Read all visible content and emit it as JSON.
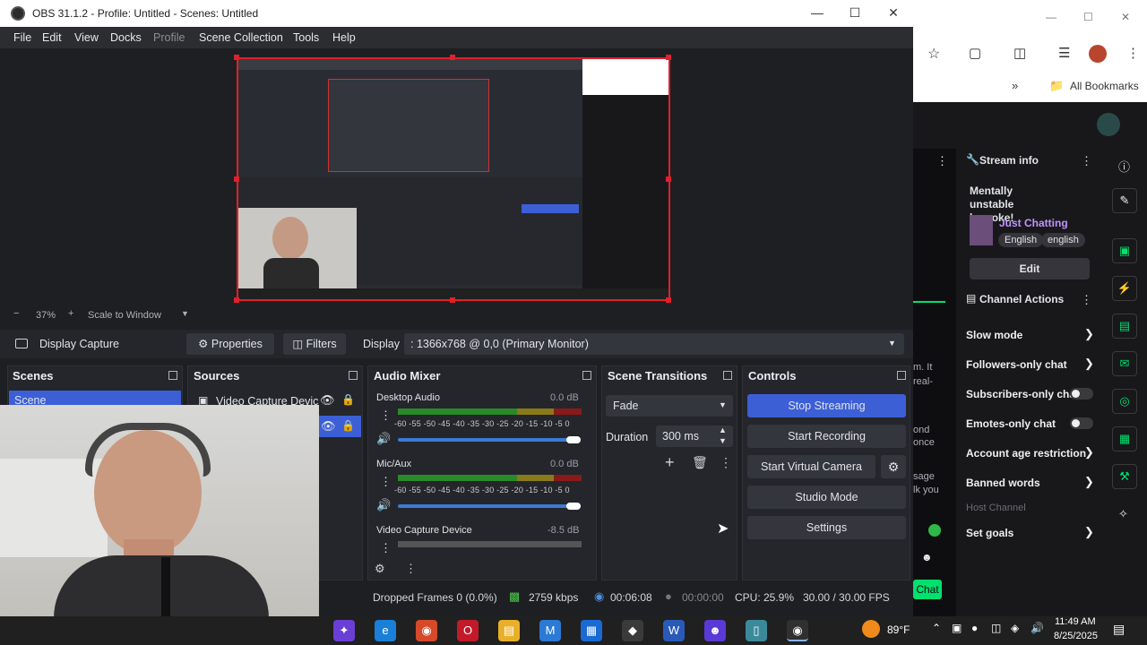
{
  "window": {
    "title": "OBS 31.1.2 - Profile: Untitled - Scenes: Untitled"
  },
  "menu": [
    "File",
    "Edit",
    "View",
    "Docks",
    "Profile",
    "Scene Collection",
    "Tools",
    "Help"
  ],
  "zoom": {
    "percent": "37%",
    "mode": "Scale to Window"
  },
  "source_toolbar": {
    "source_name": "Display Capture",
    "properties": "Properties",
    "filters": "Filters",
    "display_label": "Display",
    "display_value": ": 1366x768 @ 0,0 (Primary Monitor)"
  },
  "docks": {
    "scenes": {
      "title": "Scenes",
      "items": [
        "Scene"
      ]
    },
    "sources": {
      "title": "Sources",
      "items": [
        "Video Capture Devic"
      ]
    },
    "mixer": {
      "title": "Audio Mixer",
      "scale": "-60 -55 -50 -45 -40 -35 -30 -25 -20 -15 -10 -5 0",
      "channels": [
        {
          "name": "Desktop Audio",
          "db": "0.0 dB",
          "volume": 1.0
        },
        {
          "name": "Mic/Aux",
          "db": "0.0 dB",
          "volume": 1.0
        },
        {
          "name": "Video Capture Device",
          "db": "-8.5 dB",
          "volume": 0.85
        }
      ]
    },
    "transitions": {
      "title": "Scene Transitions",
      "type": "Fade",
      "duration_label": "Duration",
      "duration": "300 ms"
    },
    "controls": {
      "title": "Controls",
      "stop_streaming": "Stop Streaming",
      "start_recording": "Start Recording",
      "start_virtual_camera": "Start Virtual Camera",
      "studio_mode": "Studio Mode",
      "settings": "Settings"
    }
  },
  "status": {
    "dropped_frames": "Dropped Frames 0 (0.0%)",
    "bitrate": "2759 kbps",
    "stream_time": "00:06:08",
    "record_time": "00:00:00",
    "cpu": "CPU: 25.9%",
    "fps": "30.00 / 30.00 FPS"
  },
  "browser": {
    "bookmarks": "All Bookmarks",
    "stream_info": {
      "header": "Stream info",
      "title": "Mentally unstable karaoke!",
      "category": "Just Chatting",
      "tags": [
        "English",
        "english"
      ],
      "edit": "Edit"
    },
    "channel_actions": {
      "header": "Channel Actions",
      "items": [
        "Slow mode",
        "Followers-only chat",
        "Subscribers-only chat",
        "Emotes-only chat",
        "Account age restriction",
        "Banned words",
        "Host Channel",
        "Set goals"
      ]
    },
    "chat_snippets": [
      "m. It",
      "real-",
      "ond",
      "once",
      "sage",
      "lk you"
    ],
    "chat_button": "Chat"
  },
  "taskbar": {
    "weather": "89°F",
    "time": "11:49 AM",
    "date": "8/25/2025"
  },
  "colors": {
    "accent": "#3c5fd6",
    "twitch_purple": "#9147ff",
    "twitch_green": "#00e06e",
    "rec_red": "#e0202a"
  }
}
